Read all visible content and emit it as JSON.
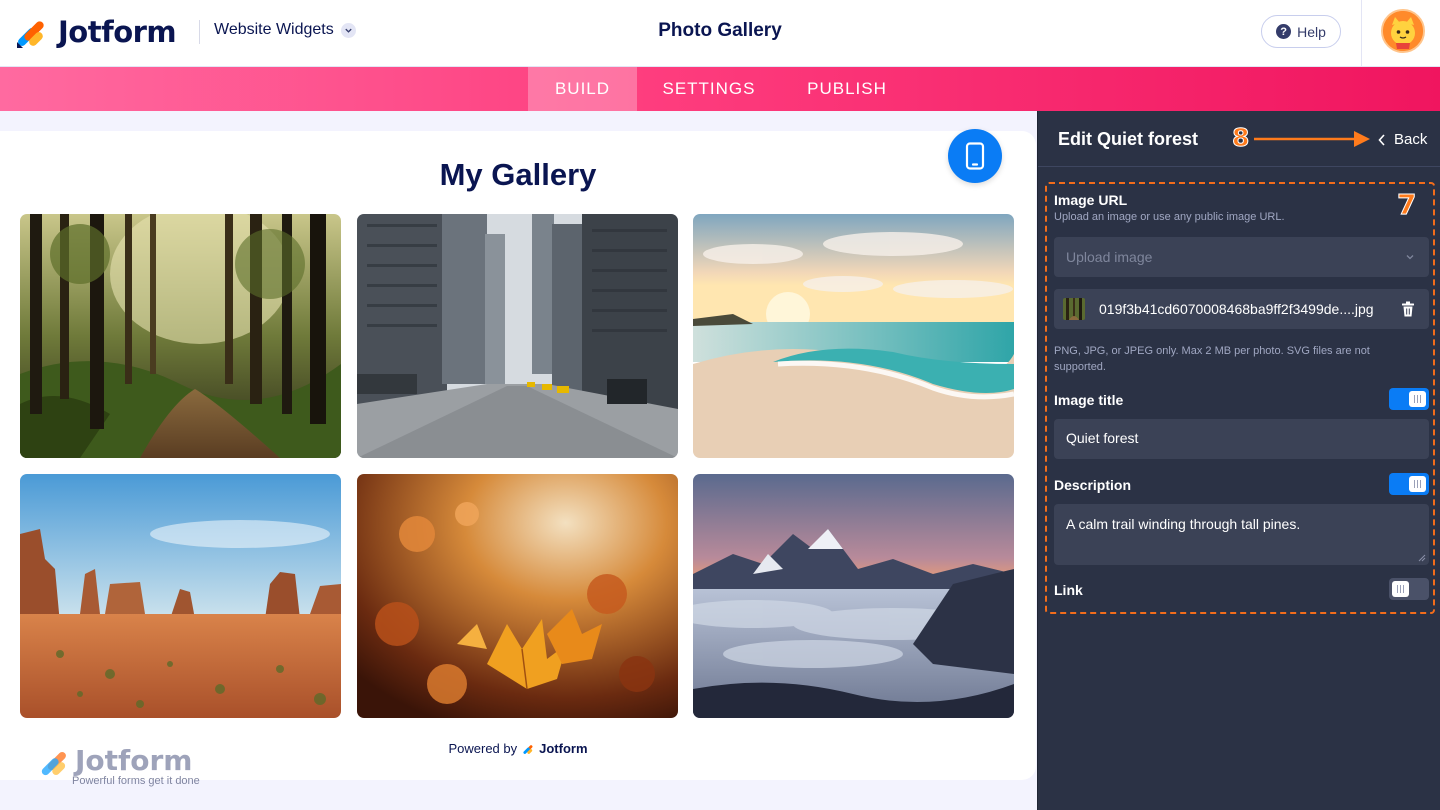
{
  "header": {
    "brand": "Jotform",
    "product": "Website Widgets",
    "page_title": "Photo Gallery",
    "help_label": "Help"
  },
  "nav": {
    "tabs": [
      {
        "label": "BUILD",
        "active": true
      },
      {
        "label": "SETTINGS",
        "active": false
      },
      {
        "label": "PUBLISH",
        "active": false
      }
    ]
  },
  "canvas": {
    "gallery_title": "My Gallery",
    "photos": [
      {
        "name": "forest"
      },
      {
        "name": "city street"
      },
      {
        "name": "beach sunset"
      },
      {
        "name": "desert canyon"
      },
      {
        "name": "autumn leaves"
      },
      {
        "name": "mountain above clouds"
      }
    ],
    "powered_prefix": "Powered by",
    "powered_brand": "Jotform",
    "watermark_brand": "Jotform",
    "watermark_tagline": "Powerful forms get it done"
  },
  "panel": {
    "title": "Edit Quiet forest",
    "back_label": "Back",
    "callout_back": "8",
    "callout_box": "7",
    "image_url_label": "Image URL",
    "image_url_hint": "Upload an image or use any public image URL.",
    "upload_placeholder": "Upload image",
    "file_name": "019f3b41cd6070008468ba9ff2f3499de....jpg",
    "file_note": "PNG, JPG, or JPEG only. Max 2 MB per photo. SVG files are not supported.",
    "image_title_label": "Image title",
    "image_title_value": "Quiet forest",
    "image_title_enabled": true,
    "description_label": "Description",
    "description_value": "A calm trail winding through tall pines.",
    "description_enabled": true,
    "link_label": "Link",
    "link_enabled": false
  },
  "colors": {
    "accent_pink": "#fe3d7e",
    "toggle_on": "#0a7cf5",
    "callout_orange": "#ff7b1c",
    "panel_bg": "#2b3245"
  }
}
